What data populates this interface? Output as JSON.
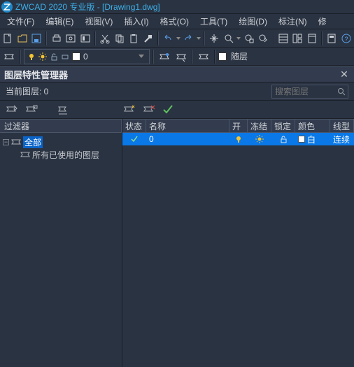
{
  "titlebar": {
    "text": "ZWCAD 2020 专业版 - [Drawing1.dwg]"
  },
  "menubar": {
    "items": [
      {
        "label": "文件(F)"
      },
      {
        "label": "编辑(E)"
      },
      {
        "label": "视图(V)"
      },
      {
        "label": "插入(I)"
      },
      {
        "label": "格式(O)"
      },
      {
        "label": "工具(T)"
      },
      {
        "label": "绘图(D)"
      },
      {
        "label": "标注(N)"
      },
      {
        "label": "修"
      }
    ]
  },
  "toolbar2": {
    "layer_combo_label": "随层"
  },
  "panel": {
    "title": "图层特性管理器",
    "current_layer_label": "当前图层: 0",
    "search_placeholder": "搜索图层"
  },
  "filter": {
    "header": "过滤器",
    "root": "全部",
    "child": "所有已使用的图层"
  },
  "table": {
    "headers": {
      "status": "状态",
      "name": "名称",
      "on": "开",
      "freeze": "冻结",
      "lock": "锁定",
      "color": "颜色",
      "linetype": "线型"
    },
    "rows": [
      {
        "name": "0",
        "color_label": "白",
        "linetype": "连续"
      }
    ]
  }
}
